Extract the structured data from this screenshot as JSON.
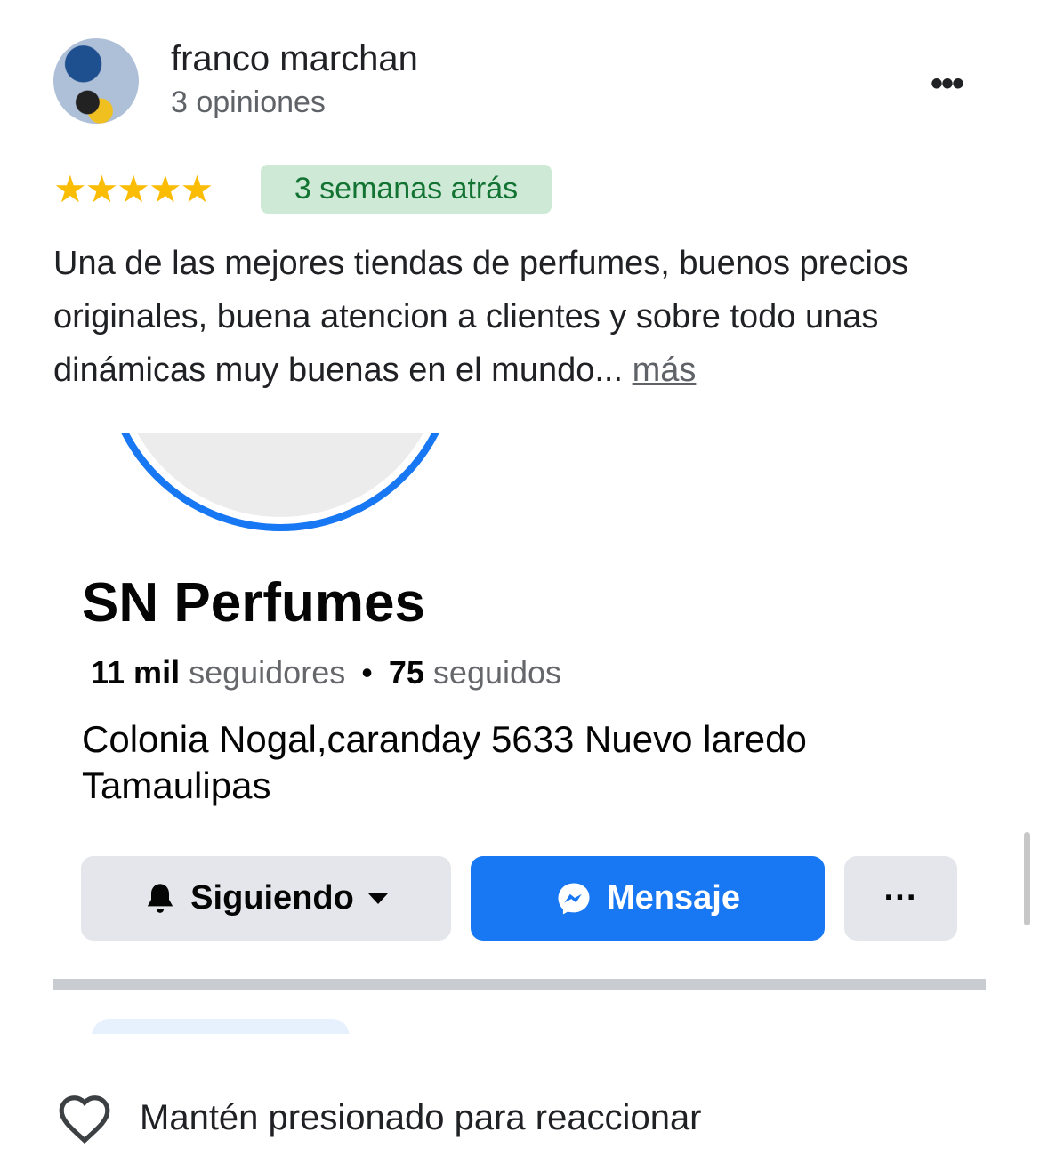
{
  "review": {
    "reviewer_name": "franco marchan",
    "review_count": "3 opiniones",
    "rating": 5,
    "rating_max": 5,
    "stars": "★★★★★",
    "time_ago": "3 semanas atrás",
    "text": "Una de las mejores tiendas de perfumes, buenos precios originales, buena atencion a clientes y sobre todo unas dinámicas muy buenas  en el mundo...",
    "more_label": "más",
    "star_color": "#fbbc04",
    "badge_color": "#ceead6"
  },
  "photo": {
    "page_name": "SN Perfumes",
    "followers_count": "11 mil",
    "followers_label": "seguidores",
    "separator": "•",
    "following_count": "75",
    "following_label": "seguidos",
    "address": "Colonia Nogal,caranday 5633 Nuevo laredo Tamaulipas",
    "following_button": "Siguiendo",
    "message_button": "Mensaje",
    "more_button": "···",
    "accent_color": "#1877f2"
  },
  "footer": {
    "react_hint": "Mantén presionado para reaccionar"
  }
}
